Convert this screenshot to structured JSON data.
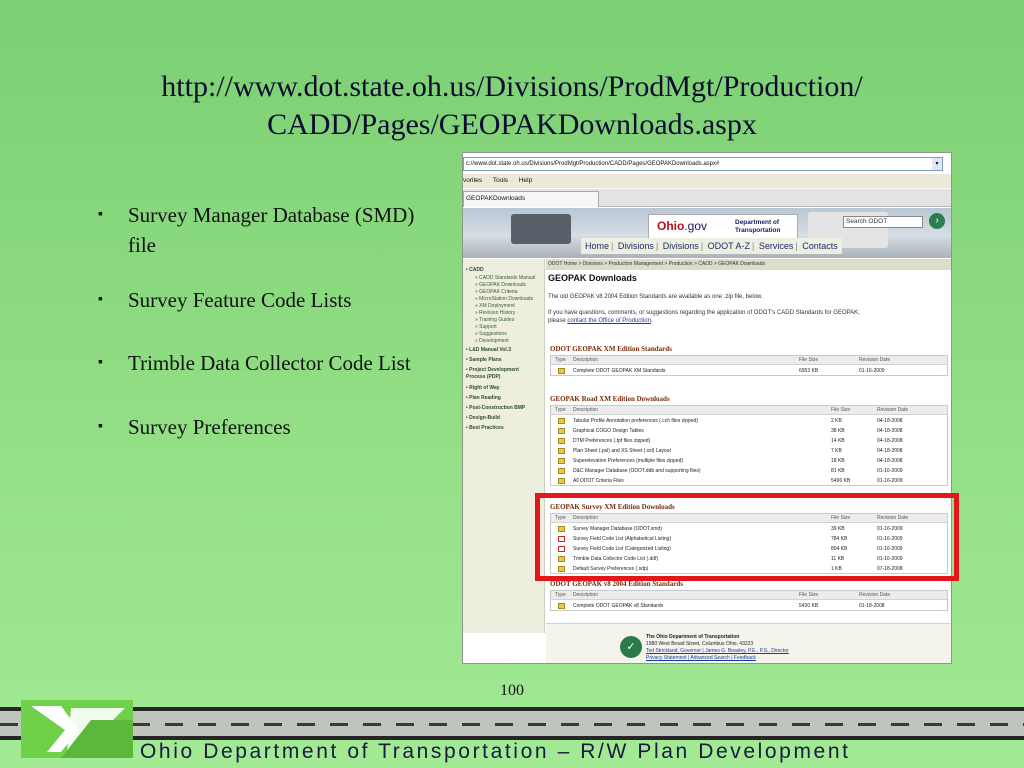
{
  "slide": {
    "title_line1": "http://www.dot.state.oh.us/Divisions/ProdMgt/Production/",
    "title_line2": "CADD/Pages/GEOPAKDownloads.aspx",
    "bullet_glyph": "▪",
    "bullets": [
      "Survey Manager Database (SMD) file",
      "Survey Feature Code Lists",
      "Trimble Data Collector Code List",
      "Survey Preferences"
    ],
    "page_number": "100",
    "footer_text": "Ohio Department of Transportation – R/W Plan Development",
    "highlight_color": "#e3171b",
    "background_color": "#8edc82"
  },
  "browser": {
    "address": "c://www.dot.state.oh.us/Divisions/ProdMgt/Production/CADD/Pages/GEOPAKDownloads.aspx#",
    "menu": [
      "vorites",
      "Tools",
      "Help"
    ],
    "tab_title": "GEOPAKDownloads"
  },
  "site": {
    "logo_text": "Ohio",
    "logo_suffix": ".gov",
    "dept_line1": "Department of",
    "dept_line2": "Transportation",
    "search_placeholder": "Search ODOT",
    "nav": [
      "Home",
      "Divisions",
      "Divisions",
      "ODOT A-Z",
      "Services",
      "Contacts"
    ],
    "left_nav": [
      {
        "label": "• CADD",
        "level": "main"
      },
      {
        "label": "» CADD Standards Manual",
        "level": "sub"
      },
      {
        "label": "» GEOPAK Downloads",
        "level": "sub"
      },
      {
        "label": "» GEOPAK Criteria",
        "level": "sub"
      },
      {
        "label": "» MicroStation Downloads",
        "level": "sub"
      },
      {
        "label": "» XM Deployment",
        "level": "sub"
      },
      {
        "label": "» Revision History",
        "level": "sub"
      },
      {
        "label": "» Training Guides",
        "level": "sub"
      },
      {
        "label": "» Support",
        "level": "sub"
      },
      {
        "label": "» Suggestions",
        "level": "sub"
      },
      {
        "label": "» Development",
        "level": "sub"
      },
      {
        "label": "• L&D Manual Vol.3",
        "level": "main"
      },
      {
        "label": "• Sample Plans",
        "level": "main"
      },
      {
        "label": "• Project Development",
        "level": "main"
      },
      {
        "label": "  Process (PDP)",
        "level": "main"
      },
      {
        "label": "• Right of Way",
        "level": "main"
      },
      {
        "label": "• Plan Reading",
        "level": "main"
      },
      {
        "label": "• Post-Construction BMP",
        "level": "main"
      },
      {
        "label": "• Design-Build",
        "level": "main"
      },
      {
        "label": "• Best Practices",
        "level": "main"
      }
    ],
    "breadcrumb": "ODOT Home > Divisions > Production Management > Production > CADD > GEOPAK Downloads",
    "page_title": "GEOPAK Downloads",
    "intro": "The old GEOPAK v8 2004 Edition Standards are available as one .zip file, below.",
    "question_text": "If you have questions, comments, or suggestions regarding the application of ODOT's CADD Standards for GEOPAK,",
    "question_text2": "please",
    "question_link": "contact the Office of Production",
    "question_end": ".",
    "col_type": "Type",
    "col_desc": "Description",
    "col_size": "File Size",
    "col_date": "Revision Date",
    "sections": [
      {
        "title": "ODOT GEOPAK XM Edition Standards",
        "rows": [
          {
            "icon": "zip",
            "desc": "Complete ODOT GEOPAK XM Standards",
            "size": "6953 KB",
            "date": "01-16-2009"
          }
        ]
      },
      {
        "title": "GEOPAK Road XM Edition Downloads",
        "rows": [
          {
            "icon": "zip",
            "desc": "Tabular Profile Annotation preferences (.cch files zipped)",
            "size": "2 KB",
            "date": "04-18-2008"
          },
          {
            "icon": "zip",
            "desc": "Graphical COGO Design Tables",
            "size": "38 KB",
            "date": "04-18-2008"
          },
          {
            "icon": "zip",
            "desc": "DTM Preferences (.tpf files zipped)",
            "size": "14 KB",
            "date": "04-18-2008"
          },
          {
            "icon": "zip",
            "desc": "Plan Sheet (.psl) and XS Sheet (.xsl) Layout",
            "size": "7 KB",
            "date": "04-18-2008"
          },
          {
            "icon": "zip",
            "desc": "Superelevation Preferences (multiple files zipped)",
            "size": "18 KB",
            "date": "04-18-2008"
          },
          {
            "icon": "zip",
            "desc": "D&C Manager Database (ODOT.ddb and supporting files)",
            "size": "81 KB",
            "date": "01-16-2009"
          },
          {
            "icon": "zip",
            "desc": "All ODOT Criteria Files",
            "size": "5496 KB",
            "date": "01-16-2009"
          }
        ]
      },
      {
        "title": "GEOPAK Survey XM Edition Downloads",
        "rows": [
          {
            "icon": "zip",
            "desc": "Survey Manager Database (ODOT.smd)",
            "size": "39 KB",
            "date": "01-16-2009"
          },
          {
            "icon": "pdf",
            "desc": "Survey Field Code List (Alphabetical Listing)",
            "size": "784 KB",
            "date": "01-16-2009"
          },
          {
            "icon": "pdf",
            "desc": "Survey Field Code List (Categorized Listing)",
            "size": "804 KB",
            "date": "01-16-2009"
          },
          {
            "icon": "zip",
            "desc": "Trimble Data Collector Code List (.ddf)",
            "size": "11 KB",
            "date": "01-16-2009"
          },
          {
            "icon": "zip",
            "desc": "Default Survey Preferences (.sdp)",
            "size": "1 KB",
            "date": "07-18-2008"
          }
        ]
      },
      {
        "title": "ODOT GEOPAK v8 2004 Edition Standards",
        "rows": [
          {
            "icon": "zip",
            "desc": "Complete ODOT GEOPAK v8 Standards",
            "size": "5430 KB",
            "date": "01-18-2008"
          }
        ]
      }
    ],
    "footer": {
      "line1": "The Ohio Department of Transportation",
      "line2": "1980 West Broad Street, Columbus Ohio, 43223",
      "line3": "Ted Strickland, Governor | James G. Beasley, P.E., P.S., Director",
      "line4": "Privacy Statement | Advanced Search | Feedback"
    }
  }
}
